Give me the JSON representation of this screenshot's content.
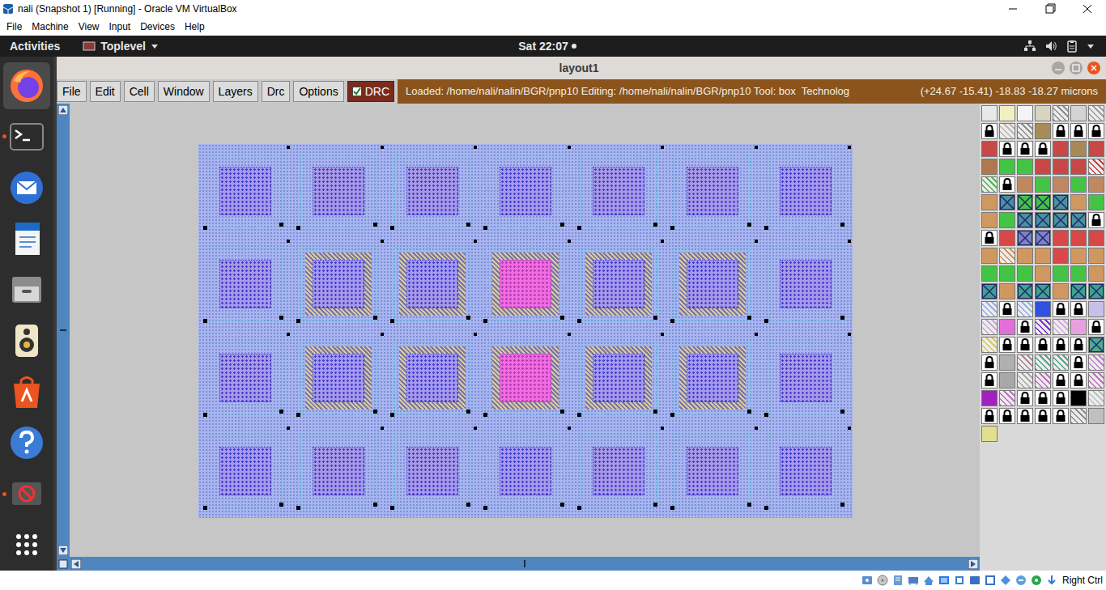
{
  "window": {
    "title": "nali (Snapshot 1) [Running] - Oracle VM VirtualBox"
  },
  "host_menu": [
    "File",
    "Machine",
    "View",
    "Input",
    "Devices",
    "Help"
  ],
  "top_bar": {
    "activities": "Activities",
    "app_menu": "Toplevel",
    "clock": "Sat 22:07",
    "notification": true
  },
  "dock": [
    {
      "kind": "firefox",
      "selected": true,
      "running": false
    },
    {
      "kind": "terminal",
      "selected": false,
      "running": true
    },
    {
      "kind": "thunderbird",
      "selected": false,
      "running": false
    },
    {
      "kind": "writer",
      "selected": false,
      "running": false
    },
    {
      "kind": "files",
      "selected": false,
      "running": false
    },
    {
      "kind": "rhythmbox",
      "selected": false,
      "running": false
    },
    {
      "kind": "software",
      "selected": false,
      "running": false
    },
    {
      "kind": "help",
      "selected": false,
      "running": false
    },
    {
      "kind": "blocked",
      "selected": false,
      "running": true
    },
    {
      "kind": "apps",
      "selected": false,
      "running": false
    }
  ],
  "magic": {
    "title": "layout1",
    "menu": [
      "File",
      "Edit",
      "Cell",
      "Window",
      "Layers",
      "Drc",
      "Options"
    ],
    "drc": {
      "label": "DRC",
      "checked": true
    },
    "status": "Loaded: /home/nali/nalin/BGR/pnp10 Editing: /home/nali/nalin/BGR/pnp10 Tool: box  Technolog",
    "coords": "(+24.67 -15.41) -18.83 -18.27 microns",
    "cells": [
      {
        "kind": "plain"
      },
      {
        "kind": "plain"
      },
      {
        "kind": "plain"
      },
      {
        "kind": "plain"
      },
      {
        "kind": "plain"
      },
      {
        "kind": "plain"
      },
      {
        "kind": "plain"
      },
      {
        "kind": "plain"
      },
      {
        "kind": "guard"
      },
      {
        "kind": "guard"
      },
      {
        "kind": "emitter"
      },
      {
        "kind": "guard"
      },
      {
        "kind": "guard"
      },
      {
        "kind": "plain"
      },
      {
        "kind": "plain"
      },
      {
        "kind": "guard"
      },
      {
        "kind": "guard"
      },
      {
        "kind": "emitter"
      },
      {
        "kind": "guard"
      },
      {
        "kind": "guard"
      },
      {
        "kind": "plain"
      },
      {
        "kind": "plain"
      },
      {
        "kind": "plain"
      },
      {
        "kind": "plain"
      },
      {
        "kind": "plain"
      },
      {
        "kind": "plain"
      },
      {
        "kind": "plain"
      },
      {
        "kind": "plain"
      }
    ],
    "palette": [
      {
        "kind": "solid",
        "color": "#e8e8e8",
        "locked": false
      },
      {
        "kind": "solid",
        "color": "#f2f0c0",
        "locked": false
      },
      {
        "kind": "solid",
        "color": "#f4f4f4",
        "locked": false
      },
      {
        "kind": "solid",
        "color": "#d8d4c0",
        "locked": false
      },
      {
        "kind": "hatch",
        "color": "#909090",
        "locked": false
      },
      {
        "kind": "solid",
        "color": "#d4d4d4",
        "locked": false
      },
      {
        "kind": "hatch",
        "color": "#a0a0a0",
        "locked": false
      },
      {
        "kind": "solid",
        "color": "#ffffff",
        "locked": true
      },
      {
        "kind": "hatch",
        "color": "#c0b8b0",
        "locked": false
      },
      {
        "kind": "hatch",
        "color": "#909090",
        "locked": false
      },
      {
        "kind": "solid",
        "color": "#a88c58",
        "locked": false
      },
      {
        "kind": "solid",
        "color": "#ffffff",
        "locked": true
      },
      {
        "kind": "solid",
        "color": "#ffffff",
        "locked": true
      },
      {
        "kind": "solid",
        "color": "#ffffff",
        "locked": true
      },
      {
        "kind": "solid",
        "color": "#c84848",
        "locked": false
      },
      {
        "kind": "solid",
        "color": "#ffffff",
        "locked": true
      },
      {
        "kind": "solid",
        "color": "#ffffff",
        "locked": true
      },
      {
        "kind": "solid",
        "color": "#ffffff",
        "locked": true
      },
      {
        "kind": "solid",
        "color": "#c84848",
        "locked": false
      },
      {
        "kind": "solid",
        "color": "#a88858",
        "locked": false
      },
      {
        "kind": "solid",
        "color": "#c84848",
        "locked": false
      },
      {
        "kind": "solid",
        "color": "#b07850",
        "locked": false
      },
      {
        "kind": "solid",
        "color": "#44c444",
        "locked": false
      },
      {
        "kind": "solid",
        "color": "#44c444",
        "locked": false
      },
      {
        "kind": "solid",
        "color": "#c84848",
        "locked": false
      },
      {
        "kind": "solid",
        "color": "#c84848",
        "locked": false
      },
      {
        "kind": "solid",
        "color": "#c84848",
        "locked": false
      },
      {
        "kind": "hatch",
        "color": "#c84848",
        "locked": false
      },
      {
        "kind": "hatch",
        "color": "#50b850",
        "locked": false
      },
      {
        "kind": "solid",
        "color": "#ffffff",
        "locked": true
      },
      {
        "kind": "solid",
        "color": "#c08860",
        "locked": false
      },
      {
        "kind": "solid",
        "color": "#44c444",
        "locked": false
      },
      {
        "kind": "solid",
        "color": "#c08860",
        "locked": false
      },
      {
        "kind": "solid",
        "color": "#44c444",
        "locked": false
      },
      {
        "kind": "solid",
        "color": "#c08860",
        "locked": false
      },
      {
        "kind": "solid",
        "color": "#d09860",
        "locked": false
      },
      {
        "kind": "cross",
        "color": "#4a90a0",
        "locked": false
      },
      {
        "kind": "cross",
        "color": "#44c444",
        "locked": false
      },
      {
        "kind": "cross",
        "color": "#44c444",
        "locked": false
      },
      {
        "kind": "cross",
        "color": "#4a90a0",
        "locked": false
      },
      {
        "kind": "solid",
        "color": "#d09860",
        "locked": false
      },
      {
        "kind": "solid",
        "color": "#44c444",
        "locked": false
      },
      {
        "kind": "solid",
        "color": "#d09860",
        "locked": false
      },
      {
        "kind": "solid",
        "color": "#44c444",
        "locked": false
      },
      {
        "kind": "cross",
        "color": "#4a90a0",
        "locked": false
      },
      {
        "kind": "cross",
        "color": "#4a90a0",
        "locked": false
      },
      {
        "kind": "cross",
        "color": "#4a90a0",
        "locked": false
      },
      {
        "kind": "cross",
        "color": "#4a90a0",
        "locked": false
      },
      {
        "kind": "solid",
        "color": "#ffffff",
        "locked": true
      },
      {
        "kind": "solid",
        "color": "#ffffff",
        "locked": true
      },
      {
        "kind": "solid",
        "color": "#d84848",
        "locked": false
      },
      {
        "kind": "cross",
        "color": "#8080c8",
        "locked": false
      },
      {
        "kind": "cross",
        "color": "#8080c8",
        "locked": false
      },
      {
        "kind": "solid",
        "color": "#d84848",
        "locked": false
      },
      {
        "kind": "solid",
        "color": "#d84848",
        "locked": false
      },
      {
        "kind": "solid",
        "color": "#d84848",
        "locked": false
      },
      {
        "kind": "solid",
        "color": "#d09860",
        "locked": false
      },
      {
        "kind": "hatch",
        "color": "#d09860",
        "locked": false
      },
      {
        "kind": "solid",
        "color": "#d09860",
        "locked": false
      },
      {
        "kind": "solid",
        "color": "#d09860",
        "locked": false
      },
      {
        "kind": "solid",
        "color": "#d84848",
        "locked": false
      },
      {
        "kind": "solid",
        "color": "#d09860",
        "locked": false
      },
      {
        "kind": "solid",
        "color": "#d09860",
        "locked": false
      },
      {
        "kind": "solid",
        "color": "#44c444",
        "locked": false
      },
      {
        "kind": "solid",
        "color": "#44c444",
        "locked": false
      },
      {
        "kind": "solid",
        "color": "#44c444",
        "locked": false
      },
      {
        "kind": "solid",
        "color": "#d09860",
        "locked": false
      },
      {
        "kind": "solid",
        "color": "#44c444",
        "locked": false
      },
      {
        "kind": "solid",
        "color": "#44c444",
        "locked": false
      },
      {
        "kind": "solid",
        "color": "#d09860",
        "locked": false
      },
      {
        "kind": "cross",
        "color": "#40a090",
        "locked": false
      },
      {
        "kind": "solid",
        "color": "#d09860",
        "locked": false
      },
      {
        "kind": "cross",
        "color": "#40a090",
        "locked": false
      },
      {
        "kind": "cross",
        "color": "#40a090",
        "locked": false
      },
      {
        "kind": "solid",
        "color": "#d09860",
        "locked": false
      },
      {
        "kind": "cross",
        "color": "#40a090",
        "locked": false
      },
      {
        "kind": "cross",
        "color": "#40a090",
        "locked": false
      },
      {
        "kind": "hatch",
        "color": "#90b0e8",
        "locked": false
      },
      {
        "kind": "solid",
        "color": "#ffffff",
        "locked": true
      },
      {
        "kind": "hatch",
        "color": "#90b0e8",
        "locked": false
      },
      {
        "kind": "solid",
        "color": "#3050e0",
        "locked": false
      },
      {
        "kind": "solid",
        "color": "#ffffff",
        "locked": true
      },
      {
        "kind": "solid",
        "color": "#ffffff",
        "locked": true
      },
      {
        "kind": "solid",
        "color": "#c8c0e8",
        "locked": false
      },
      {
        "kind": "hatch",
        "color": "#c8a8d8",
        "locked": false
      },
      {
        "kind": "solid",
        "color": "#e070d8",
        "locked": false
      },
      {
        "kind": "solid",
        "color": "#ffffff",
        "locked": true
      },
      {
        "kind": "hatch",
        "color": "#8030c8",
        "locked": false
      },
      {
        "kind": "hatch",
        "color": "#d8a8e0",
        "locked": false
      },
      {
        "kind": "solid",
        "color": "#e8a0e0",
        "locked": false
      },
      {
        "kind": "solid",
        "color": "#ffffff",
        "locked": true
      },
      {
        "kind": "hatch",
        "color": "#d8c860",
        "locked": false
      },
      {
        "kind": "solid",
        "color": "#ffffff",
        "locked": true
      },
      {
        "kind": "solid",
        "color": "#ffffff",
        "locked": true
      },
      {
        "kind": "solid",
        "color": "#ffffff",
        "locked": true
      },
      {
        "kind": "solid",
        "color": "#ffffff",
        "locked": true
      },
      {
        "kind": "solid",
        "color": "#ffffff",
        "locked": true
      },
      {
        "kind": "cross",
        "color": "#50a890",
        "locked": false
      },
      {
        "kind": "solid",
        "color": "#ffffff",
        "locked": true
      },
      {
        "kind": "solid",
        "color": "#b0b0b0",
        "locked": false
      },
      {
        "kind": "hatch",
        "color": "#b08898",
        "locked": false
      },
      {
        "kind": "hatch",
        "color": "#50a890",
        "locked": false
      },
      {
        "kind": "hatch",
        "color": "#50a890",
        "locked": false
      },
      {
        "kind": "solid",
        "color": "#ffffff",
        "locked": true
      },
      {
        "kind": "hatch",
        "color": "#c080d0",
        "locked": false
      },
      {
        "kind": "solid",
        "color": "#ffffff",
        "locked": true
      },
      {
        "kind": "solid",
        "color": "#a8a8a8",
        "locked": false
      },
      {
        "kind": "hatch",
        "color": "#a8a8a8",
        "locked": false
      },
      {
        "kind": "hatch",
        "color": "#c070c0",
        "locked": false
      },
      {
        "kind": "solid",
        "color": "#ffffff",
        "locked": true
      },
      {
        "kind": "solid",
        "color": "#ffffff",
        "locked": true
      },
      {
        "kind": "hatch",
        "color": "#c070c0",
        "locked": false
      },
      {
        "kind": "solid",
        "color": "#a020c0",
        "locked": false
      },
      {
        "kind": "hatch",
        "color": "#c070c0",
        "locked": false
      },
      {
        "kind": "solid",
        "color": "#ffffff",
        "locked": true
      },
      {
        "kind": "solid",
        "color": "#ffffff",
        "locked": true
      },
      {
        "kind": "solid",
        "color": "#ffffff",
        "locked": true
      },
      {
        "kind": "solid",
        "color": "#000000",
        "locked": false
      },
      {
        "kind": "hatch",
        "color": "#c0c0c0",
        "locked": false
      },
      {
        "kind": "solid",
        "color": "#ffffff",
        "locked": true
      },
      {
        "kind": "solid",
        "color": "#ffffff",
        "locked": true
      },
      {
        "kind": "solid",
        "color": "#ffffff",
        "locked": true
      },
      {
        "kind": "solid",
        "color": "#ffffff",
        "locked": true
      },
      {
        "kind": "solid",
        "color": "#ffffff",
        "locked": true
      },
      {
        "kind": "hatch",
        "color": "#909090",
        "locked": false
      },
      {
        "kind": "solid",
        "color": "#c0c0c0",
        "locked": false
      },
      {
        "kind": "solid",
        "color": "#e0e090",
        "locked": false
      }
    ]
  },
  "status_bar": {
    "host_key": "Right Ctrl"
  }
}
